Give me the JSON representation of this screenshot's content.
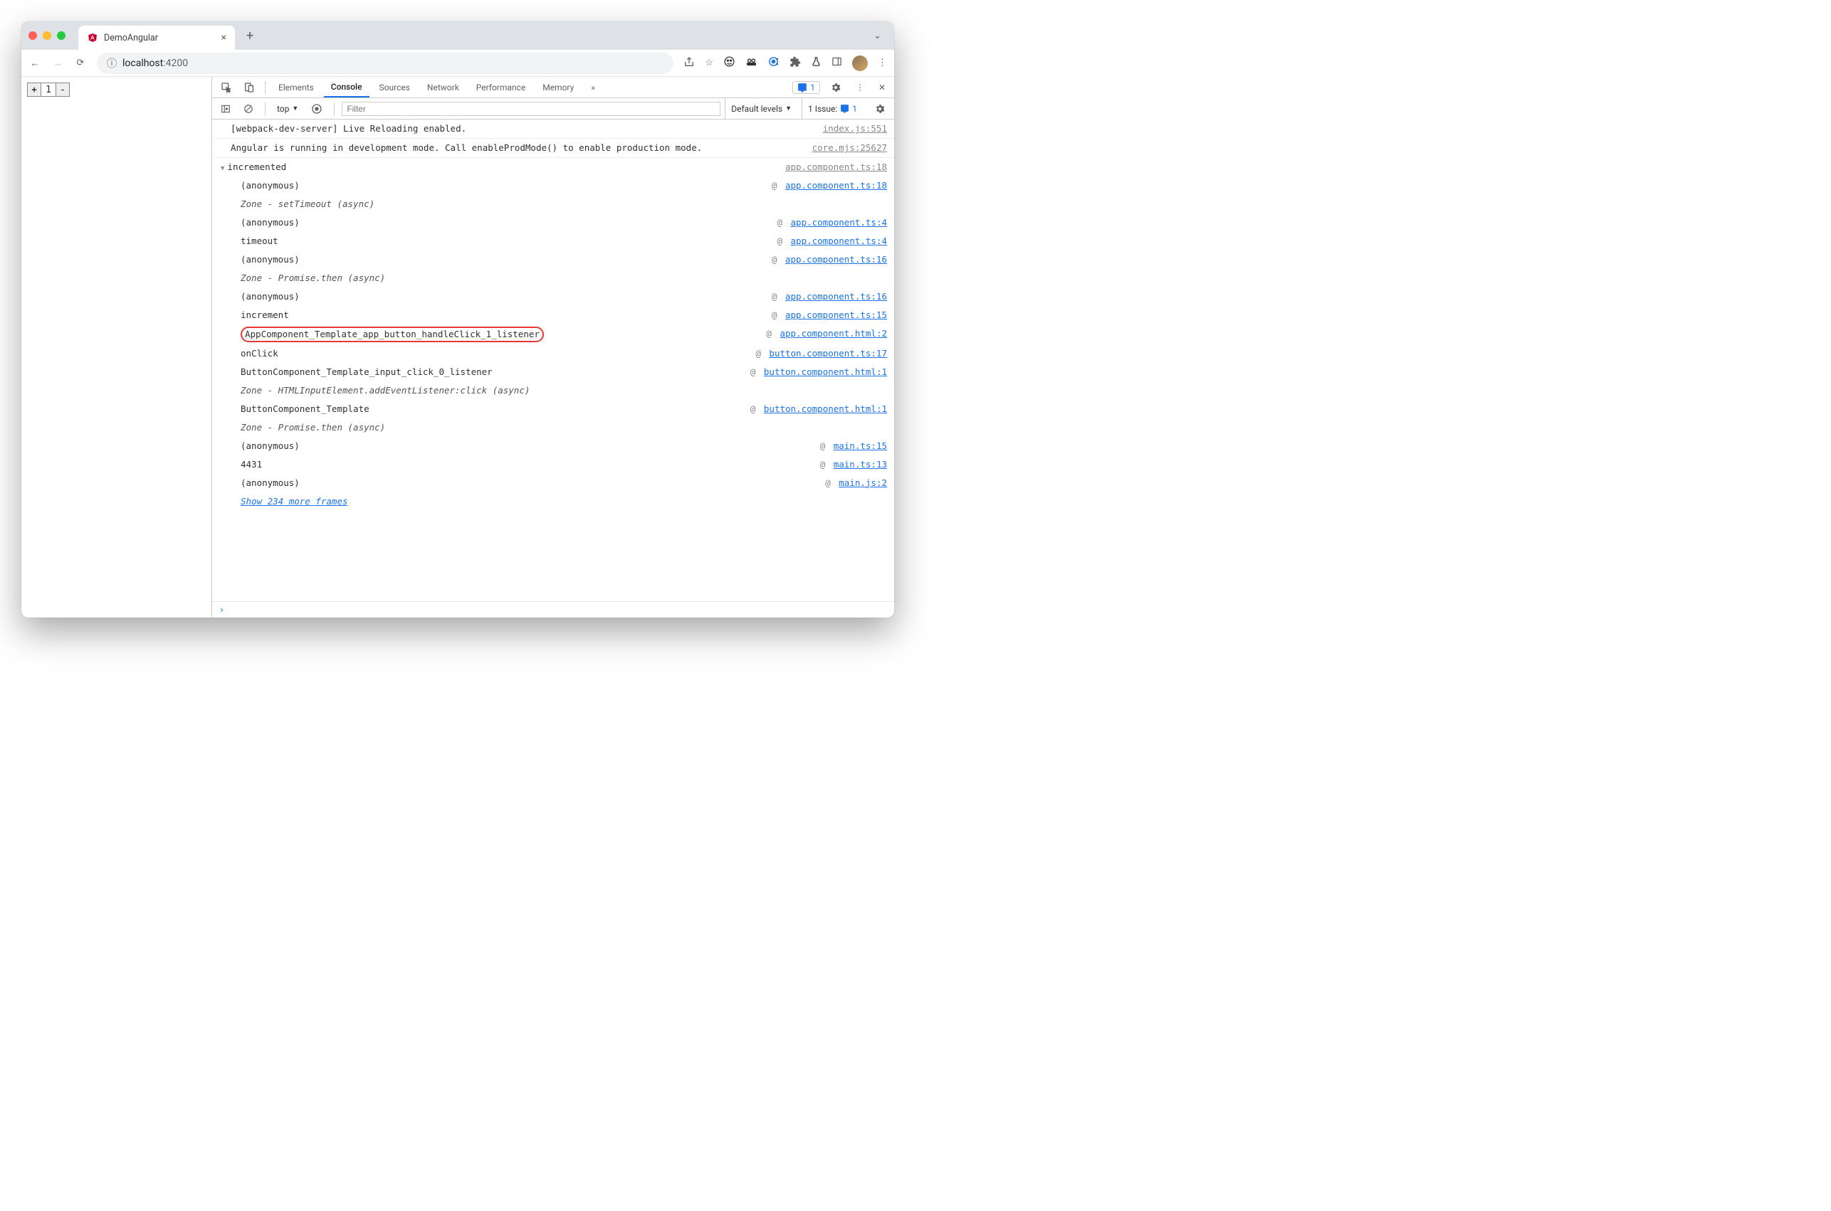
{
  "browser": {
    "tab_title": "DemoAngular",
    "url_host": "localhost",
    "url_port": ":4200"
  },
  "page": {
    "counter_value": "1",
    "plus": "+",
    "minus": "-"
  },
  "devtools": {
    "tabs": {
      "elements": "Elements",
      "console": "Console",
      "sources": "Sources",
      "network": "Network",
      "performance": "Performance",
      "memory": "Memory",
      "more": "»"
    },
    "issues_count": "1",
    "sub": {
      "context": "top",
      "filter_placeholder": "Filter",
      "levels": "Default levels",
      "issue_prefix": "1 Issue:",
      "issue_count": "1"
    }
  },
  "console": {
    "rows": [
      {
        "type": "log",
        "indent": 0,
        "msg": "[webpack-dev-server] Live Reloading enabled.",
        "src": "index.js:551",
        "srcStyle": "gray",
        "border": true
      },
      {
        "type": "log",
        "indent": 0,
        "msg": "Angular is running in development mode. Call enableProdMode() to enable production mode.",
        "src": "core.mjs:25627",
        "srcStyle": "gray",
        "border": true
      },
      {
        "type": "group",
        "indent": 0,
        "caret": true,
        "msg": "incremented",
        "src": "app.component.ts:18",
        "srcStyle": "gray"
      },
      {
        "type": "stack",
        "indent": 1,
        "msg": "(anonymous)",
        "at": "@",
        "src": "app.component.ts:18",
        "srcStyle": "blue"
      },
      {
        "type": "zone",
        "indent": 1,
        "msg": "Zone - setTimeout (async)"
      },
      {
        "type": "stack",
        "indent": 1,
        "msg": "(anonymous)",
        "at": "@",
        "src": "app.component.ts:4",
        "srcStyle": "blue"
      },
      {
        "type": "stack",
        "indent": 1,
        "msg": "timeout",
        "at": "@",
        "src": "app.component.ts:4",
        "srcStyle": "blue"
      },
      {
        "type": "stack",
        "indent": 1,
        "msg": "(anonymous)",
        "at": "@",
        "src": "app.component.ts:16",
        "srcStyle": "blue"
      },
      {
        "type": "zone",
        "indent": 1,
        "msg": "Zone - Promise.then (async)"
      },
      {
        "type": "stack",
        "indent": 1,
        "msg": "(anonymous)",
        "at": "@",
        "src": "app.component.ts:16",
        "srcStyle": "blue"
      },
      {
        "type": "stack",
        "indent": 1,
        "msg": "increment",
        "at": "@",
        "src": "app.component.ts:15",
        "srcStyle": "blue"
      },
      {
        "type": "stack",
        "indent": 1,
        "highlight": true,
        "msg": "AppComponent_Template_app_button_handleClick_1_listener",
        "at": "@",
        "src": "app.component.html:2",
        "srcStyle": "blue"
      },
      {
        "type": "stack",
        "indent": 1,
        "msg": "onClick",
        "at": "@",
        "src": "button.component.ts:17",
        "srcStyle": "blue"
      },
      {
        "type": "stack",
        "indent": 1,
        "msg": "ButtonComponent_Template_input_click_0_listener",
        "at": "@",
        "src": "button.component.html:1",
        "srcStyle": "blue"
      },
      {
        "type": "zone",
        "indent": 1,
        "msg": "Zone - HTMLInputElement.addEventListener:click (async)"
      },
      {
        "type": "stack",
        "indent": 1,
        "msg": "ButtonComponent_Template",
        "at": "@",
        "src": "button.component.html:1",
        "srcStyle": "blue"
      },
      {
        "type": "zone",
        "indent": 1,
        "msg": "Zone - Promise.then (async)"
      },
      {
        "type": "stack",
        "indent": 1,
        "msg": "(anonymous)",
        "at": "@",
        "src": "main.ts:15",
        "srcStyle": "blue"
      },
      {
        "type": "stack",
        "indent": 1,
        "msg": "4431",
        "at": "@",
        "src": "main.ts:13",
        "srcStyle": "blue"
      },
      {
        "type": "stack",
        "indent": 1,
        "msg": "(anonymous)",
        "at": "@",
        "src": "main.js:2",
        "srcStyle": "blue"
      },
      {
        "type": "showmore",
        "indent": 1,
        "msg": "Show 234 more frames"
      }
    ],
    "prompt": "›"
  }
}
